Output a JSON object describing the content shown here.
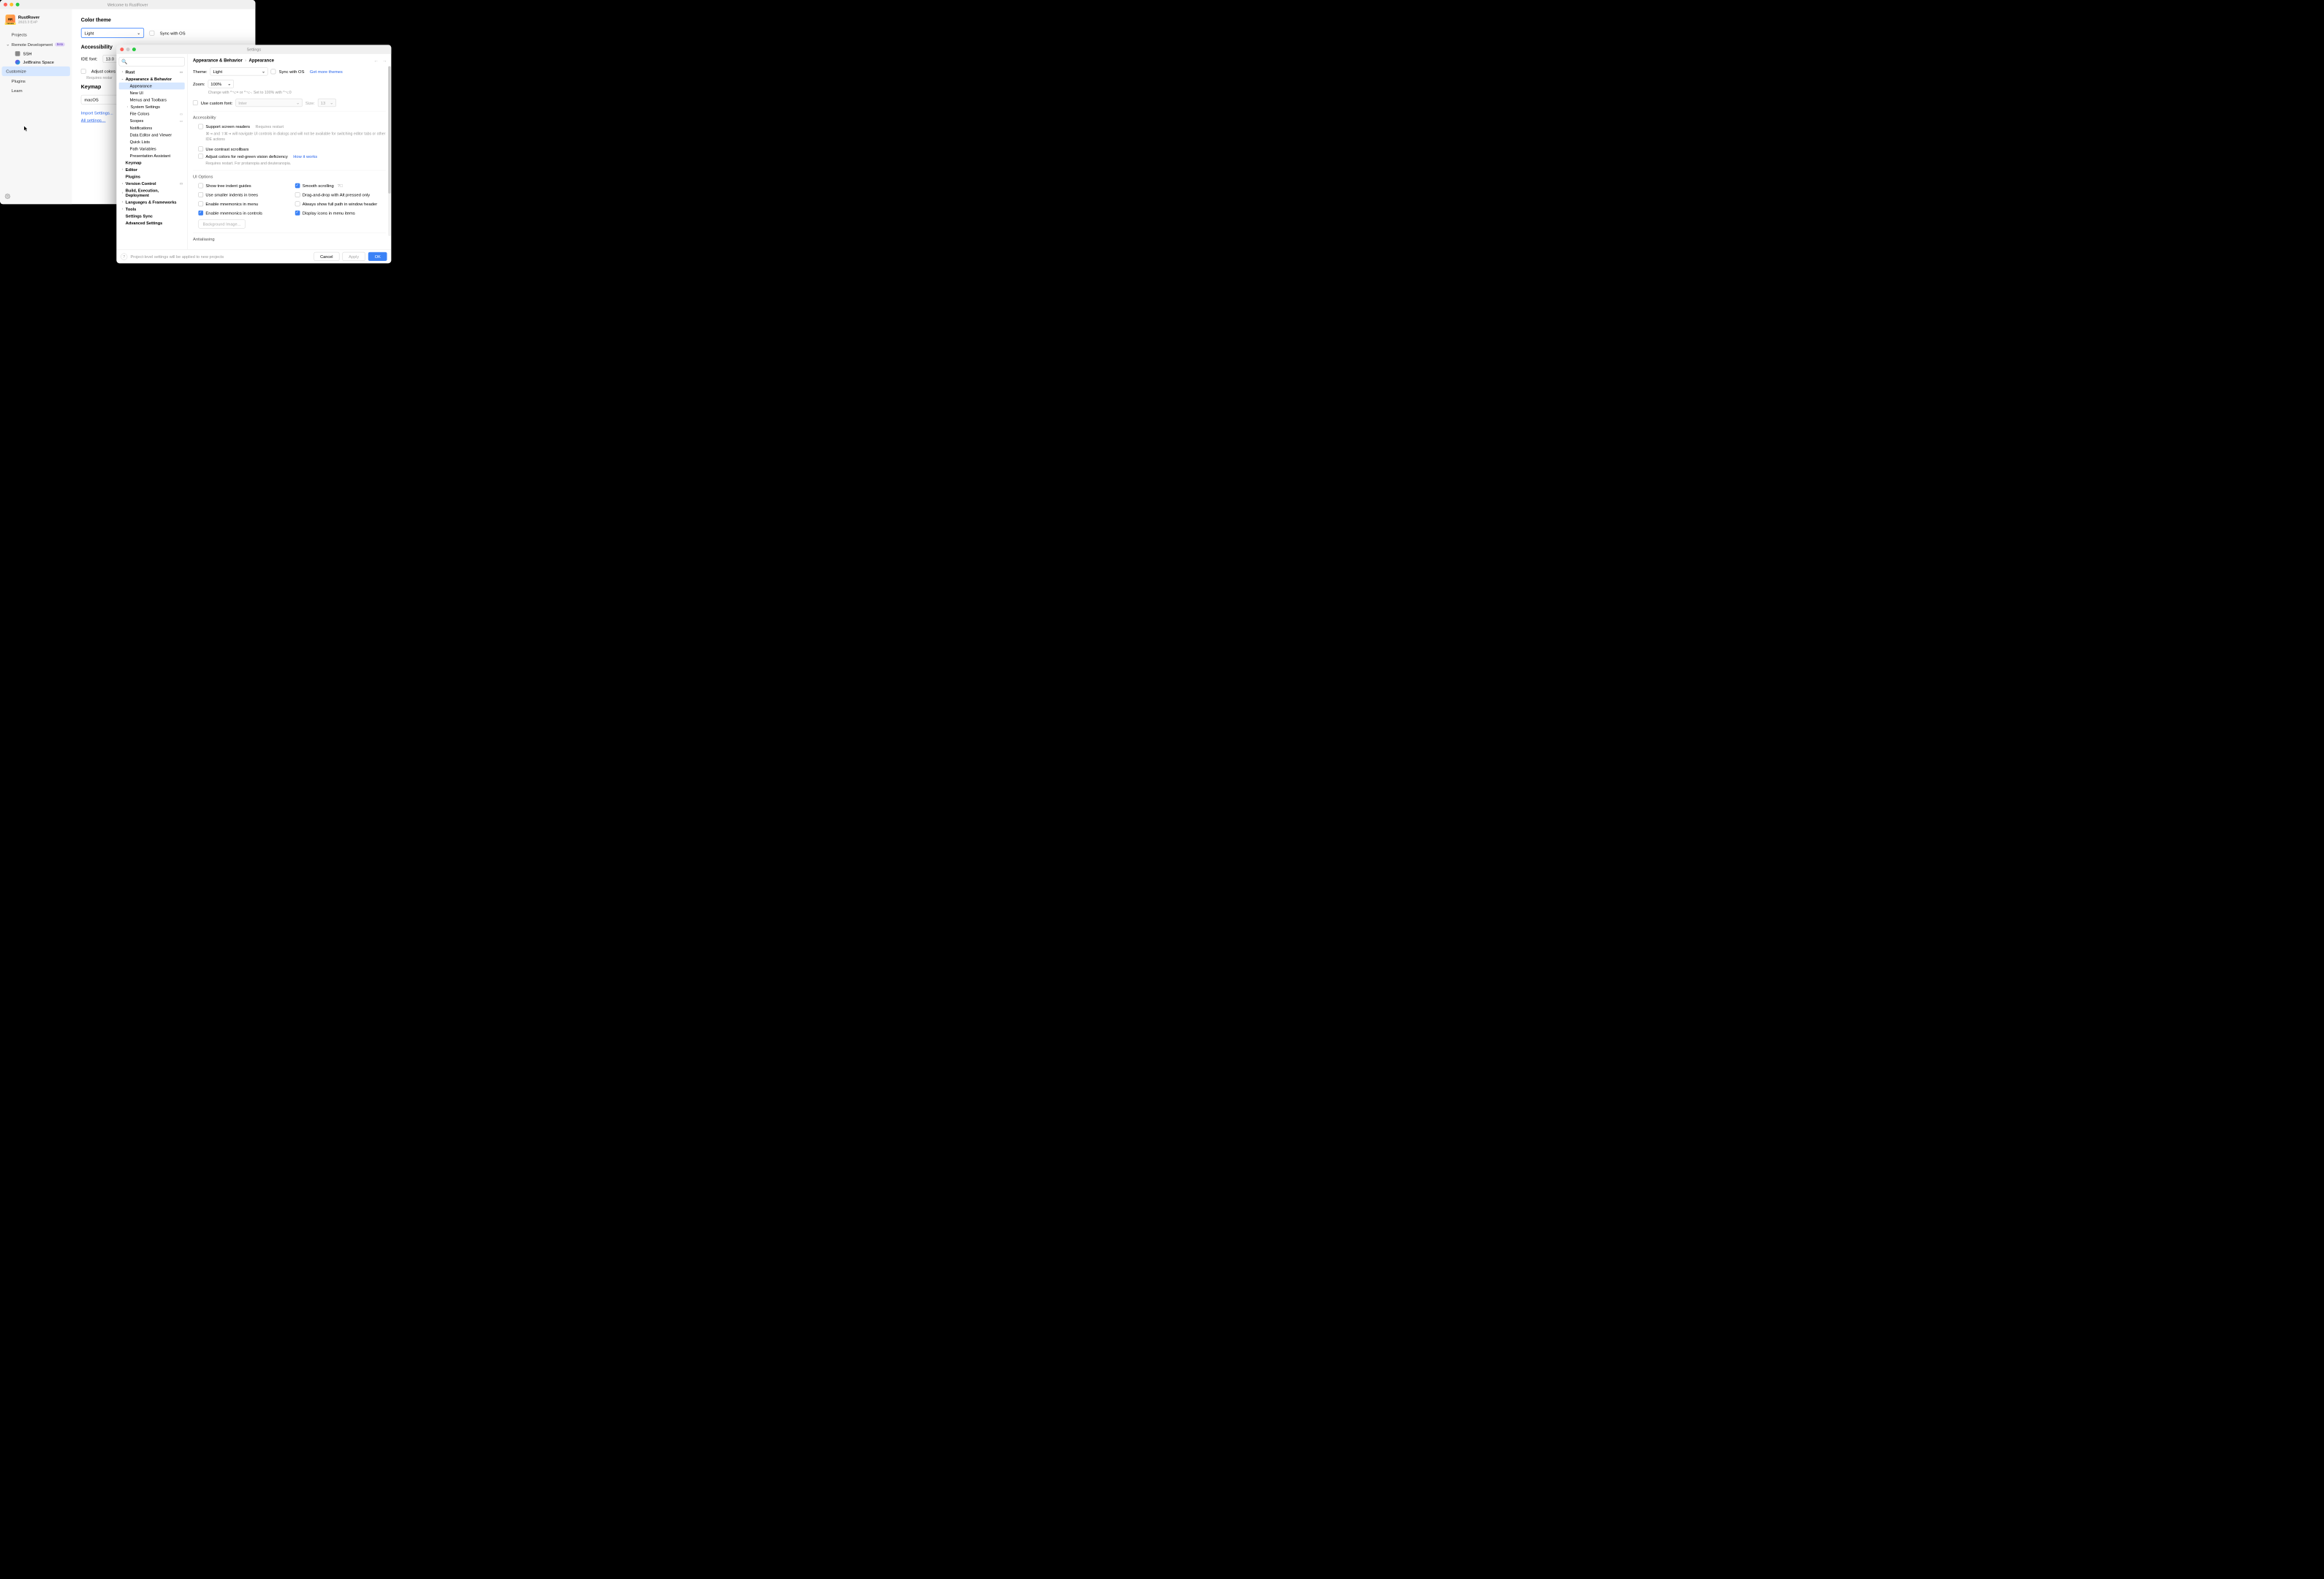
{
  "welcome": {
    "title": "Welcome to RustRover",
    "app_name": "RustRover",
    "app_version": "2023.3 EAP",
    "nav": {
      "projects": "Projects",
      "remote": "Remote Development",
      "remote_badge": "Beta",
      "ssh": "SSH",
      "space": "JetBrains Space",
      "customize": "Customize",
      "plugins": "Plugins",
      "learn": "Learn"
    },
    "main": {
      "color_theme_title": "Color theme",
      "theme_value": "Light",
      "sync_os": "Sync with OS",
      "accessibility_title": "Accessibility",
      "ide_font_label": "IDE font:",
      "ide_font_value": "13.0",
      "adjust_colors": "Adjust colors f",
      "requires_restart": "Requires restar",
      "keymap_title": "Keymap",
      "keymap_value": "macOS",
      "import_settings": "Import Settings...",
      "all_settings": "All settings…"
    }
  },
  "settings": {
    "title": "Settings",
    "search_placeholder": "",
    "tree": {
      "rust": "Rust",
      "appearance_behavior": "Appearance & Behavior",
      "appearance": "Appearance",
      "new_ui": "New UI",
      "menus_toolbars": "Menus and Toolbars",
      "system_settings": "System Settings",
      "file_colors": "File Colors",
      "scopes": "Scopes",
      "notifications": "Notifications",
      "data_editor": "Data Editor and Viewer",
      "quick_lists": "Quick Lists",
      "path_variables": "Path Variables",
      "presentation": "Presentation Assistant",
      "keymap": "Keymap",
      "editor": "Editor",
      "plugins": "Plugins",
      "version_control": "Version Control",
      "build": "Build, Execution, Deployment",
      "languages": "Languages & Frameworks",
      "tools": "Tools",
      "settings_sync": "Settings Sync",
      "advanced": "Advanced Settings"
    },
    "breadcrumb": {
      "parent": "Appearance & Behavior",
      "current": "Appearance"
    },
    "content": {
      "theme_label": "Theme:",
      "theme_value": "Light",
      "sync_os": "Sync with OS",
      "get_themes": "Get more themes",
      "zoom_label": "Zoom:",
      "zoom_value": "100%",
      "zoom_hint": "Change with ^⌥= or ^⌥-. Set to 100% with ^⌥0",
      "custom_font": "Use custom font:",
      "font_value": "Inter",
      "size_label": "Size:",
      "size_value": "13",
      "accessibility_title": "Accessibility",
      "screen_readers": "Support screen readers",
      "requires_restart": "Requires restart",
      "screen_readers_hint": "⌘⇥ and ⇧⌘⇥ will navigate UI controls in dialogs and will not be available for switching editor tabs or other IDE actions",
      "contrast_scrollbars": "Use contrast scrollbars",
      "adjust_colors": "Adjust colors for red-green vision deficiency",
      "how_it_works": "How it works",
      "adjust_hint": "Requires restart. For protanopia and deuteranopia.",
      "ui_options_title": "UI Options",
      "tree_indent": "Show tree indent guides",
      "smooth_scrolling": "Smooth scrolling",
      "smaller_indents": "Use smaller indents in trees",
      "drag_drop_alt": "Drag-and-drop with Alt pressed only",
      "mnemonics_menu": "Enable mnemonics in menu",
      "full_path": "Always show full path in window header",
      "mnemonics_controls": "Enable mnemonics in controls",
      "display_icons": "Display icons in menu items",
      "background_image": "Background Image...",
      "antialiasing_title": "Antialiasing"
    },
    "footer": {
      "hint": "Project-level settings will be applied to new projects",
      "cancel": "Cancel",
      "apply": "Apply",
      "ok": "OK"
    }
  }
}
